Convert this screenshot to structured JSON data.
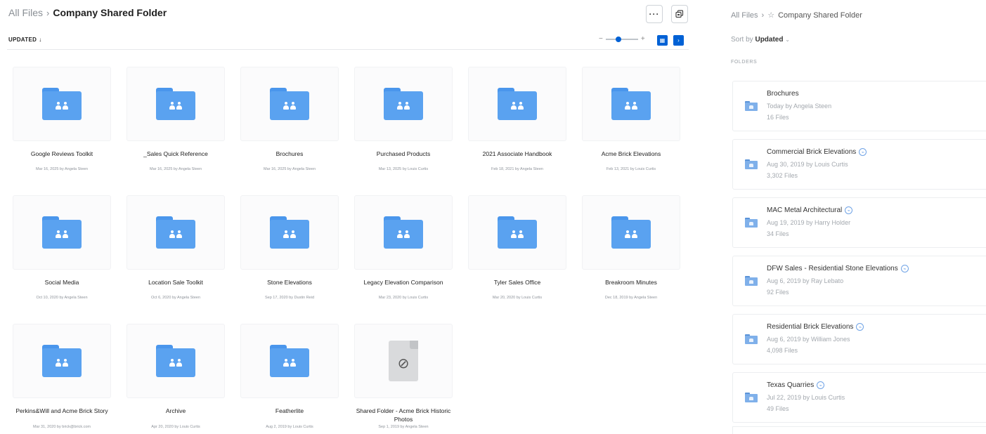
{
  "left_panel": {
    "breadcrumb": {
      "root": "All Files",
      "current": "Company Shared Folder"
    },
    "toolbar": {
      "more_label": "···",
      "new_icon": "copy-icon"
    },
    "sort": {
      "label": "UPDATED",
      "arrow": "↓"
    },
    "zoom": {
      "minus": "−",
      "plus": "+"
    },
    "tiles": [
      {
        "name": "Google Reviews Toolkit",
        "meta": "Mar 16, 2025 by Angela Steen",
        "kind": "shared-folder"
      },
      {
        "name": "_Sales Quick Reference",
        "meta": "Mar 16, 2025 by Angela Steen",
        "kind": "shared-folder"
      },
      {
        "name": "Brochures",
        "meta": "Mar 16, 2025 by Angela Steen",
        "kind": "shared-folder"
      },
      {
        "name": "Purchased Products",
        "meta": "Mar 13, 2025 by Louis Curtis",
        "kind": "shared-folder"
      },
      {
        "name": "2021 Associate Handbook",
        "meta": "Feb 18, 2021 by Angela Steen",
        "kind": "shared-folder"
      },
      {
        "name": "Acme Brick Elevations",
        "meta": "Feb 13, 2021 by Louis Curtis",
        "kind": "shared-folder"
      },
      {
        "name": "Social Media",
        "meta": "Oct 10, 2020 by Angela Steen",
        "kind": "shared-folder"
      },
      {
        "name": "Location Sale Toolkit",
        "meta": "Oct 6, 2020 by Angela Steen",
        "kind": "shared-folder"
      },
      {
        "name": "Stone Elevations",
        "meta": "Sep 17, 2020 by Dustin Reid",
        "kind": "shared-folder"
      },
      {
        "name": "Legacy Elevation Comparison",
        "meta": "Mar 23, 2020 by Louis Curtis",
        "kind": "shared-folder"
      },
      {
        "name": "Tyler Sales Office",
        "meta": "Mar 20, 2020 by Louis Curtis",
        "kind": "shared-folder"
      },
      {
        "name": "Breakroom Minutes",
        "meta": "Dec 18, 2019 by Angela Steen",
        "kind": "shared-folder"
      },
      {
        "name": "Perkins&Will and Acme Brick Story",
        "meta": "Mar 31, 2020 by brick@brick.com",
        "kind": "shared-folder"
      },
      {
        "name": "Archive",
        "meta": "Apr 20, 2020 by Louis Curtis",
        "kind": "shared-folder"
      },
      {
        "name": "Featherlite",
        "meta": "Aug 2, 2019 by Louis Curtis",
        "kind": "shared-folder"
      },
      {
        "name": "Shared Folder - Acme Brick Historic Photos",
        "meta": "Sep 1, 2019 by Angela Steen",
        "kind": "web-link"
      }
    ]
  },
  "right_panel": {
    "breadcrumb": {
      "root": "All Files",
      "current": "Company Shared Folder",
      "star_icon": "star-outline-icon"
    },
    "sort": {
      "prefix": "Sort by",
      "value": "Updated",
      "caret": "⌄"
    },
    "section_label": "FOLDERS",
    "items": [
      {
        "title": "Brochures",
        "meta": "Today by Angela Steen",
        "count": "16 Files",
        "collab": false
      },
      {
        "title": "Commercial Brick Elevations",
        "meta": "Aug 30, 2019 by Louis Curtis",
        "count": "3,302 Files",
        "collab": true
      },
      {
        "title": "MAC Metal Architectural",
        "meta": "Aug 19, 2019 by Harry Holder",
        "count": "34 Files",
        "collab": true
      },
      {
        "title": "DFW Sales - Residential Stone Elevations",
        "meta": "Aug 6, 2019 by Ray Lebato",
        "count": "92 Files",
        "collab": true
      },
      {
        "title": "Residential Brick Elevations",
        "meta": "Aug 6, 2019 by William Jones",
        "count": "4,098 Files",
        "collab": true
      },
      {
        "title": "Texas Quarries",
        "meta": "Jul 22, 2019 by Louis Curtis",
        "count": "49 Files",
        "collab": true
      }
    ]
  },
  "colors": {
    "accent": "#0061d5",
    "folder": "#5aa2f0",
    "folder_tab": "#4a96ec",
    "muted_text": "#8e939a"
  }
}
